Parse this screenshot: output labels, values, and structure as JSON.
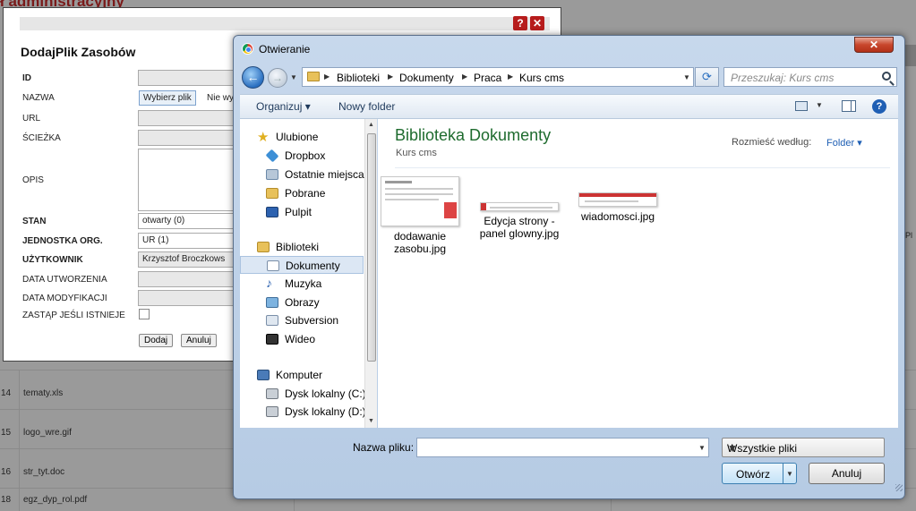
{
  "background": {
    "title": "ł administracyjny",
    "rows": [
      {
        "num": "14",
        "name": "tematy.xls"
      },
      {
        "num": "15",
        "name": "logo_wre.gif"
      },
      {
        "num": "16",
        "name": "str_tyt.doc"
      },
      {
        "num": "18",
        "name": "egz_dyp_rol.pdf"
      }
    ],
    "edge_text": "Pl"
  },
  "add_dialog": {
    "heading": "DodajPlik Zasobów",
    "help_label": "?",
    "close_label": "✕",
    "labels": {
      "id": "ID",
      "nazwa": "NAZWA",
      "url": "URL",
      "sciezka": "ŚCIEŻKA",
      "opis": "OPIS",
      "stan": "STAN",
      "jednostka": "JEDNOSTKA ORG.",
      "uzytkownik": "UŻYTKOWNIK",
      "data_utworzenia": "DATA UTWORZENIA",
      "data_modyfikacji": "DATA MODYFIKACJI",
      "zastap": "ZASTĄP JEŚLI ISTNIEJE"
    },
    "choose_file_label": "Wybierz plik",
    "file_status": "Nie wy",
    "stan_value": "otwarty (0)",
    "jednostka_value": "UR (1)",
    "uzytkownik_value": "Krzysztof Broczkows",
    "zastap_checked": false,
    "dodaj_label": "Dodaj",
    "anuluj_label": "Anuluj"
  },
  "open_dialog": {
    "title": "Otwieranie",
    "close_label": "✕",
    "breadcrumbs": [
      "Biblioteki",
      "Dokumenty",
      "Praca",
      "Kurs cms"
    ],
    "search_placeholder": "Przeszukaj: Kurs cms",
    "toolbar": {
      "organize_label": "Organizuj ▾",
      "new_folder_label": "Nowy folder",
      "help_label": "?"
    },
    "nav": {
      "favorites": {
        "label": "Ulubione",
        "items": [
          "Dropbox",
          "Ostatnie miejsca",
          "Pobrane",
          "Pulpit"
        ]
      },
      "libraries": {
        "label": "Biblioteki",
        "items": [
          "Dokumenty",
          "Muzyka",
          "Obrazy",
          "Subversion",
          "Wideo"
        ]
      },
      "computer": {
        "label": "Komputer",
        "items": [
          "Dysk lokalny (C:)",
          "Dysk lokalny (D:)"
        ]
      },
      "selected": "Dokumenty"
    },
    "library_heading": "Biblioteka Dokumenty",
    "library_subheading": "Kurs cms",
    "arrange_label": "Rozmieść według:",
    "arrange_value": "Folder ▾",
    "files": [
      {
        "line1": "dodawanie",
        "line2": "zasobu.jpg"
      },
      {
        "line1": "Edycja strony -",
        "line2": "panel glowny.jpg"
      },
      {
        "line1": "wiadomosci.jpg",
        "line2": ""
      }
    ],
    "filename_label": "Nazwa pliku:",
    "filename_value": "",
    "filter_value": "Wszystkie pliki",
    "open_label": "Otwórz",
    "cancel_label": "Anuluj"
  },
  "colors": {
    "library_heading": "#1e6b2e",
    "link_blue": "#1f5fb4",
    "dialog_close": "#b71c1c"
  },
  "icons": {
    "back": "arrow-left-icon",
    "forward": "arrow-right-icon",
    "refresh": "refresh-icon",
    "search": "search-icon",
    "help": "help-icon",
    "close": "close-icon"
  }
}
